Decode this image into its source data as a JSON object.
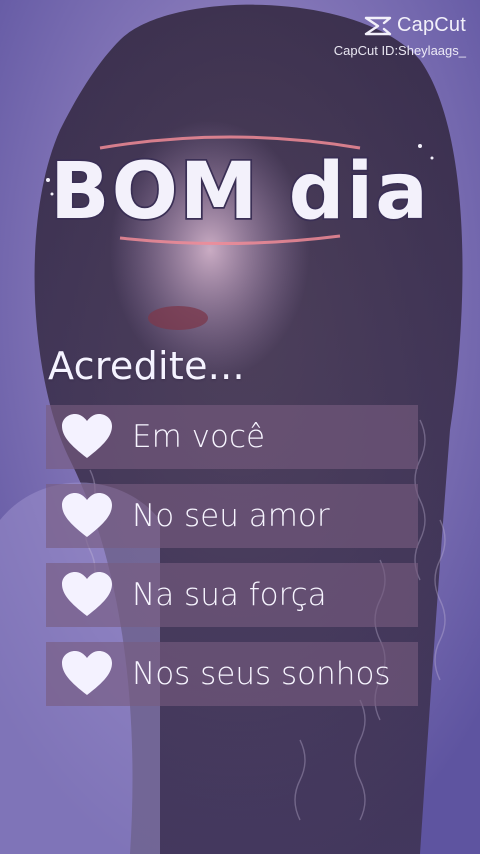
{
  "watermark": {
    "brand": "CapCut",
    "id_line": "CapCut ID:Sheylaags_"
  },
  "title": "BOM dia",
  "intro": "Acredite...",
  "items": [
    {
      "label": "Em você"
    },
    {
      "label": "No seu amor"
    },
    {
      "label": "Na sua força"
    },
    {
      "label": "Nos seus sonhos"
    }
  ],
  "colors": {
    "background": "#8b80bf",
    "panel": "#7a5c80",
    "title_outline": "#3a2f55",
    "title_fill": "#f3f1fb",
    "title_glow": "#f08b96",
    "text": "#f7f5ff"
  },
  "icons": {
    "heart": "heart-icon",
    "capcut": "capcut-logo-icon"
  }
}
